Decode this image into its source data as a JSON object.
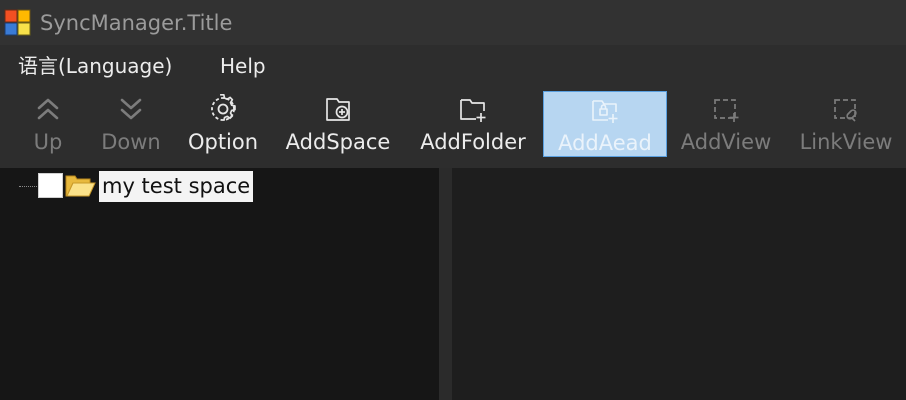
{
  "window": {
    "title": "SyncManager.Title",
    "app_icon": "windows-logo-icon"
  },
  "menu": {
    "items": [
      {
        "label": "语言(Language)"
      },
      {
        "label": "Help"
      }
    ]
  },
  "toolbar": {
    "buttons": [
      {
        "label": "Up",
        "icon": "double-chevron-up-icon",
        "enabled": false
      },
      {
        "label": "Down",
        "icon": "double-chevron-down-icon",
        "enabled": false
      },
      {
        "label": "Option",
        "icon": "gear-icon",
        "enabled": true
      },
      {
        "label": "AddSpace",
        "icon": "add-space-icon",
        "enabled": true
      },
      {
        "label": "AddFolder",
        "icon": "add-folder-icon",
        "enabled": true
      },
      {
        "label": "AddAead",
        "icon": "add-aead-icon",
        "enabled": true,
        "selected": true
      },
      {
        "label": "AddView",
        "icon": "add-view-icon",
        "enabled": false
      },
      {
        "label": "LinkView",
        "icon": "link-view-icon",
        "enabled": false
      }
    ]
  },
  "tree": {
    "items": [
      {
        "label": "my test space",
        "checked": false,
        "icon": "open-folder-icon",
        "selected": true
      }
    ]
  },
  "colors": {
    "titlebar": "#323232",
    "toolbar": "#2d2d2d",
    "selected_button": "#b7d6f1",
    "left_pane": "#161616",
    "right_pane": "#1e1e1e"
  }
}
